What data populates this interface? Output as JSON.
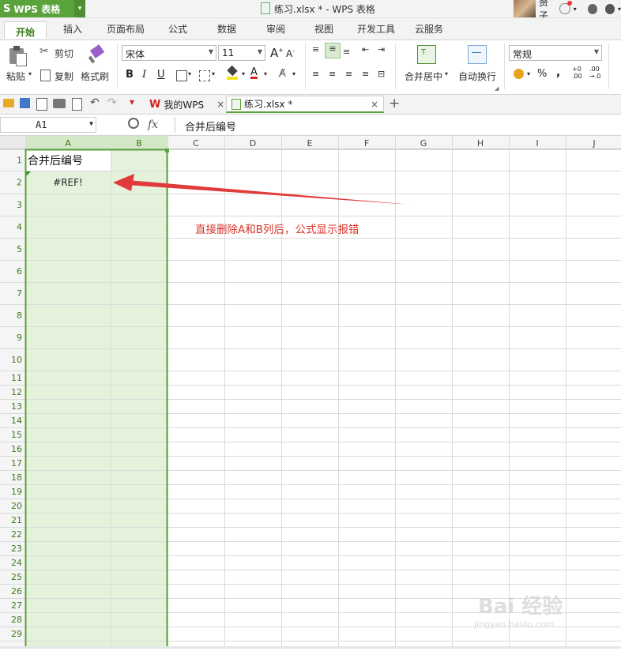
{
  "app": {
    "product_label": "WPS 表格",
    "document_title": "练习.xlsx * - WPS 表格",
    "user_name": "赘子"
  },
  "ribbon_tabs": [
    "开始",
    "插入",
    "页面布局",
    "公式",
    "数据",
    "审阅",
    "视图",
    "开发工具",
    "云服务"
  ],
  "ribbon": {
    "paste": "粘贴",
    "cut": "剪切",
    "copy": "复制",
    "format_painter": "格式刷",
    "font_name": "宋体",
    "font_size": "11",
    "merge_center": "合并居中",
    "wrap_text": "自动换行",
    "number_format": "常规",
    "bold": "B",
    "italic": "I",
    "underline": "U",
    "percent": "%",
    "comma": ",",
    "font_color_letter": "A"
  },
  "doc_tabs": [
    {
      "label": "我的WPS"
    },
    {
      "label": "练习.xlsx *"
    }
  ],
  "formula_bar": {
    "name_box": "A1",
    "fx": "fx",
    "content": "合并后编号"
  },
  "sheet": {
    "columns": [
      "A",
      "B",
      "C",
      "D",
      "E",
      "F",
      "G",
      "H",
      "I",
      "J"
    ],
    "rows": [
      "1",
      "2",
      "3",
      "4",
      "5",
      "6",
      "7",
      "8",
      "9",
      "10",
      "11",
      "12",
      "13",
      "14",
      "15",
      "16",
      "17",
      "18",
      "19",
      "20",
      "21",
      "22",
      "23",
      "24",
      "25",
      "26",
      "27",
      "28",
      "29"
    ],
    "cell_A1": "合并后编号",
    "cell_A2": "#REF!",
    "annotation": "直接删除A和B列后，公式显示报错",
    "selection_color": "#e4f2dc",
    "selection_border": "#5aa33a",
    "arrow_color": "#e03a3a"
  },
  "watermark": {
    "brand": "Bai 经验",
    "url": "jingyan.baidu.com"
  }
}
